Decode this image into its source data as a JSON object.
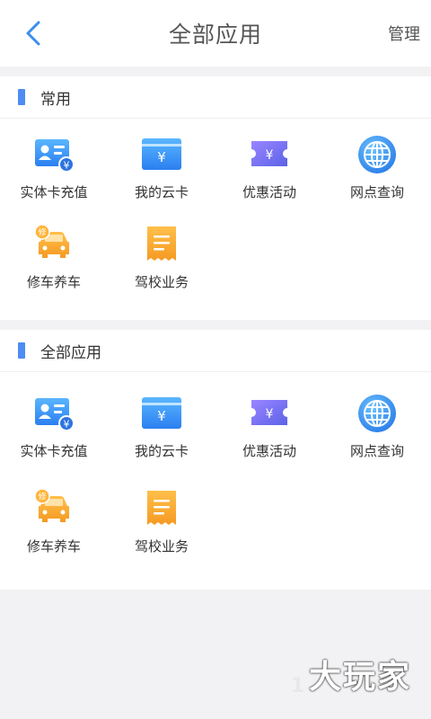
{
  "header": {
    "title": "全部应用",
    "manage": "管理"
  },
  "sections": [
    {
      "title": "常用",
      "items": [
        {
          "label": "实体卡充值",
          "icon": "id-card-yuan-icon"
        },
        {
          "label": "我的云卡",
          "icon": "yuan-card-icon"
        },
        {
          "label": "优惠活动",
          "icon": "coupon-ticket-icon"
        },
        {
          "label": "网点查询",
          "icon": "globe-icon"
        },
        {
          "label": "修车养车",
          "icon": "car-repair-icon"
        },
        {
          "label": "驾校业务",
          "icon": "receipt-icon"
        }
      ]
    },
    {
      "title": "全部应用",
      "items": [
        {
          "label": "实体卡充值",
          "icon": "id-card-yuan-icon"
        },
        {
          "label": "我的云卡",
          "icon": "yuan-card-icon"
        },
        {
          "label": "优惠活动",
          "icon": "coupon-ticket-icon"
        },
        {
          "label": "网点查询",
          "icon": "globe-icon"
        },
        {
          "label": "修车养车",
          "icon": "car-repair-icon"
        },
        {
          "label": "驾校业务",
          "icon": "receipt-icon"
        }
      ]
    }
  ],
  "watermark": {
    "number": "1",
    "text": "大玩家"
  },
  "colors": {
    "accent": "#4d8cf4",
    "background": "#f2f2f4",
    "orange": "#f7a330",
    "purple": "#7c6ff0"
  }
}
